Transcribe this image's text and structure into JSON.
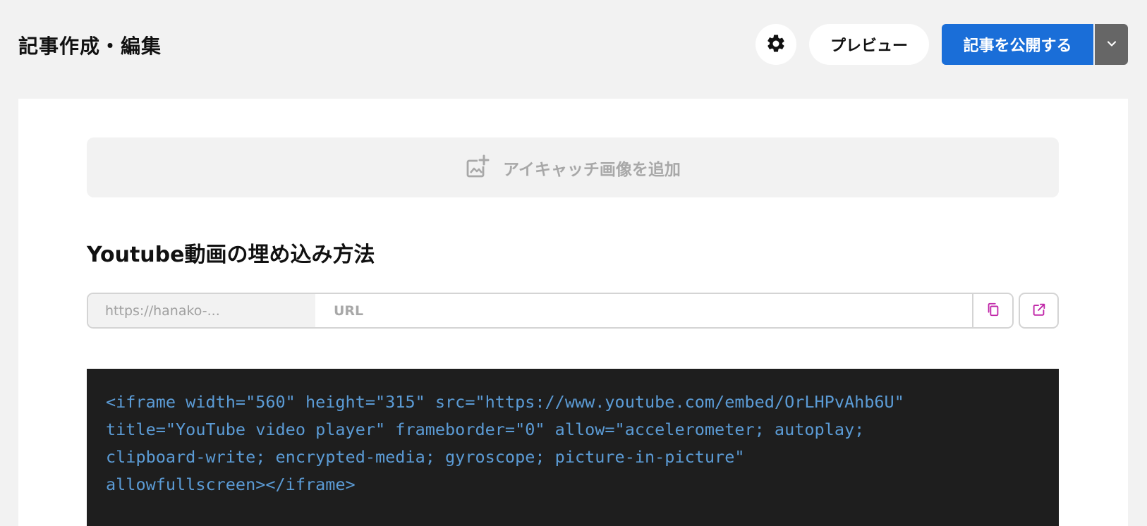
{
  "header": {
    "title": "記事作成・編集",
    "settings_icon": "gear-icon",
    "preview_label": "プレビュー",
    "publish_label": "記事を公開する",
    "dropdown_icon": "chevron-down-icon"
  },
  "editor": {
    "eyecatch_label": "アイキャッチ画像を追加",
    "eyecatch_icon": "add-image-icon",
    "article_title": "Youtube動画の埋め込み方法",
    "url_prefix": "https://hanako-...",
    "url_placeholder": "URL",
    "url_value": "",
    "copy_icon": "copy-icon",
    "open_icon": "external-link-icon",
    "code_lines": [
      "<iframe width=\"560\" height=\"315\" src=\"https://www.youtube.com/embed/OrLHPvAhb6U\"",
      "title=\"YouTube video player\" frameborder=\"0\" allow=\"accelerometer; autoplay;",
      "clipboard-write; encrypted-media; gyroscope; picture-in-picture\"",
      "allowfullscreen></iframe>"
    ]
  },
  "colors": {
    "background": "#f2f2f2",
    "accent_blue": "#1a6ed8",
    "dropdown_gray": "#666666",
    "icon_magenta": "#c026a8",
    "code_background": "#1e1e1e",
    "code_text": "#5b9bd5"
  }
}
